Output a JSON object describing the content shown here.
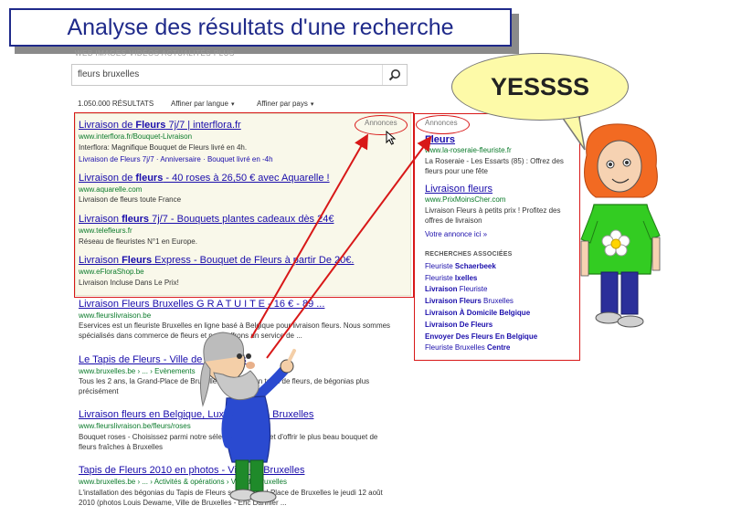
{
  "slide": {
    "title": "Analyse des résultats d'une recherche"
  },
  "header": {
    "faded_tabs": "WEB    IMAGES    VIDÉOS    ACTUALITÉS    PLUS"
  },
  "search": {
    "query": "fleurs bruxelles",
    "icon": "search-icon"
  },
  "meta": {
    "results_count": "1.050.000 RÉSULTATS",
    "filter_language": "Affiner par langue",
    "filter_country": "Affiner par pays"
  },
  "ads_label": "Annonces",
  "top_ads": [
    {
      "title_pre": "Livraison de ",
      "title_bold": "Fleurs",
      "title_post": " 7j/7 | interflora.fr",
      "url": "www.interflora.fr/Bouquet-Livraison",
      "desc": "Interflora: Magnifique Bouquet de Fleurs livré en 4h.",
      "sublinks": "Livraison de Fleurs 7j/7 · Anniversaire · Bouquet livré en -4h"
    },
    {
      "title_pre": "Livraison de ",
      "title_bold": "fleurs",
      "title_post": " - 40 roses à 26,50 € avec Aquarelle !",
      "url": "www.aquarelle.com",
      "desc": "Livraison de fleurs toute France"
    },
    {
      "title_pre": "Livraison ",
      "title_bold": "fleurs",
      "title_post": " 7j/7 - Bouquets plantes cadeaux dès 24€",
      "url": "www.telefleurs.fr",
      "desc": "Réseau de fleuristes N°1 en Europe."
    },
    {
      "title_pre": "Livraison ",
      "title_bold": "Fleurs",
      "title_post": " Express - Bouquet de Fleurs à partir De 20€.",
      "url": "www.eFloraShop.be",
      "desc": "Livraison Incluse Dans Le Prix!"
    }
  ],
  "organic": [
    {
      "title": "Livraison Fleurs Bruxelles G R A T U I T E - 16 € - 89 ...",
      "url": "www.fleurslivraison.be",
      "desc": "Eservices est un fleuriste Bruxelles en ligne basé à Belgique pour livraison fleurs. Nous sommes spécialisés dans commerce de fleurs et nous offrons un service de ..."
    },
    {
      "title": "Le Tapis de Fleurs - Ville de Bruxelles",
      "url": "www.bruxelles.be › ... › Evènements",
      "desc": "Tous les 2 ans, la Grand-Place de Bruxelles se pare d'un tapis de fleurs, de bégonias plus précisément"
    },
    {
      "title": "Livraison fleurs en Belgique, Luxembourg - Bruxelles",
      "url": "www.fleurslivraison.be/fleurs/roses",
      "desc": "Bouquet roses - Choisissez parmi notre sélection de roses et d'offrir le plus beau bouquet de fleurs fraîches à Bruxelles"
    },
    {
      "title": "Tapis de Fleurs 2010 en photos - Ville de Bruxelles",
      "url": "www.bruxelles.be › ... › Activités & opérations › Ville de Bruxelles",
      "desc": "L'installation des bégonias du Tapis de Fleurs sur la Grand-Place de Bruxelles le jeudi 12 août 2010 (photos Louis Dewame, Ville de Bruxelles - Eric Danhier ..."
    }
  ],
  "side_ads": [
    {
      "title": "Fleurs",
      "url": "www.la-roseraie-fleuriste.fr",
      "desc": "La Roseraie - Les Essarts (85) : Offrez des fleurs pour une fête"
    },
    {
      "title": "Livraison fleurs",
      "url": "www.PrixMoinsCher.com",
      "desc": "Livraison Fleurs à petits prix ! Profitez des offres de livraison"
    }
  ],
  "side_more": "Votre annonce ici »",
  "related": {
    "heading": "RECHERCHES ASSOCIÉES",
    "items": [
      {
        "pre": "Fleuriste ",
        "bold": "Schaerbeek"
      },
      {
        "pre": "Fleuriste ",
        "bold": "Ixelles"
      },
      {
        "pre": "",
        "bold": "Livraison",
        "post": " Fleuriste"
      },
      {
        "pre": "",
        "bold": "Livraison Fleurs",
        "post": " Bruxelles"
      },
      {
        "pre": "",
        "bold": "Livraison À Domicile Belgique"
      },
      {
        "pre": "",
        "bold": "Livraison De Fleurs"
      },
      {
        "pre": "",
        "bold": "Envoyer Des Fleurs En Belgique"
      },
      {
        "pre": "Fleuriste Bruxelles ",
        "bold": "Centre"
      }
    ]
  },
  "speech_bubble": {
    "text": "YESSSS"
  },
  "colors": {
    "title_blue": "#1f2a8a",
    "annotation_red": "#d81818",
    "link_blue": "#1a0dab",
    "url_green": "#0a7a2a",
    "ad_background": "#f9f8ea",
    "bubble_yellow": "#fdfaa8"
  }
}
